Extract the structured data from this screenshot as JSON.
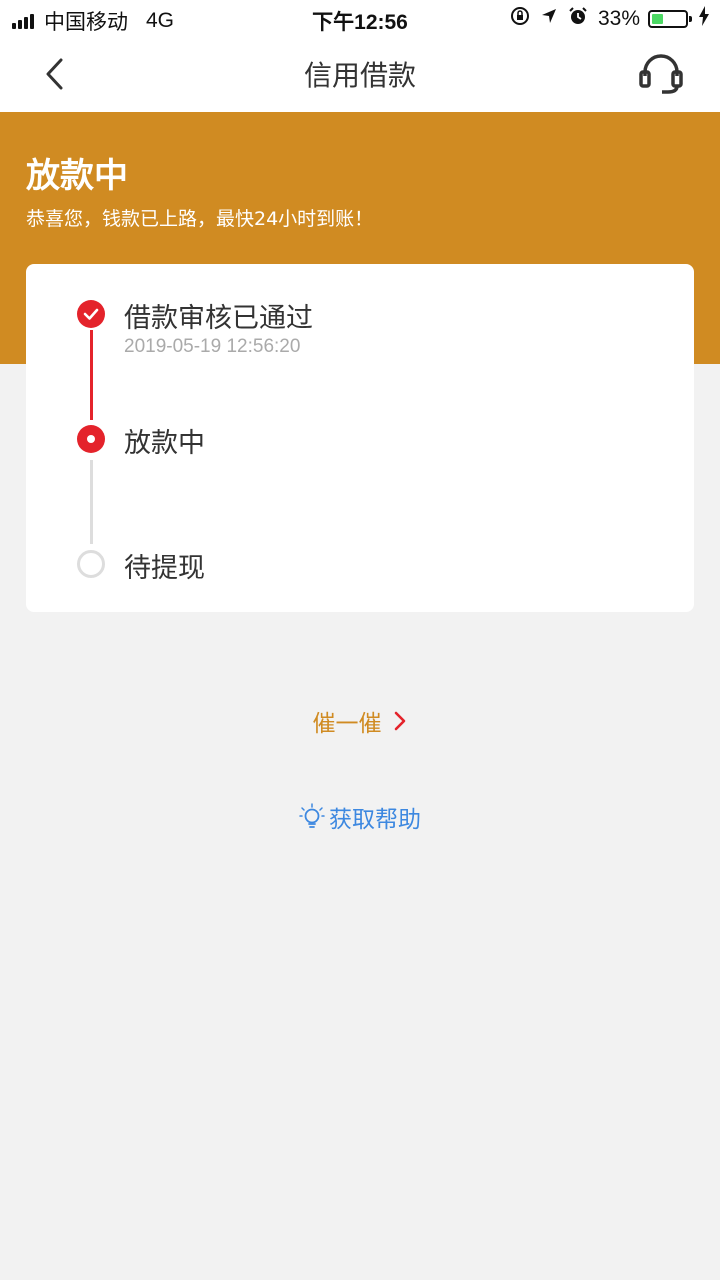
{
  "status_bar": {
    "carrier": "中国移动",
    "network": "4G",
    "time": "下午12:56",
    "battery": "33%",
    "battery_level": 0.33,
    "icons": [
      "signal-icon",
      "orientation-lock-icon",
      "location-icon",
      "alarm-icon",
      "battery-icon",
      "charging-icon"
    ]
  },
  "nav": {
    "title": "信用借款",
    "back_icon": "chevron-left-icon",
    "support_icon": "headset-icon"
  },
  "hero": {
    "title": "放款中",
    "subtitle": "恭喜您，钱款已上路，最快24小时到账！",
    "background_color": "#d08b22"
  },
  "progress": {
    "steps": [
      {
        "label": "借款审核已通过",
        "time": "2019-05-19 12:56:20",
        "state": "done"
      },
      {
        "label": "放款中",
        "time": "",
        "state": "active"
      },
      {
        "label": "待提现",
        "time": "",
        "state": "pending"
      }
    ],
    "accent_color": "#e4232b"
  },
  "actions": {
    "urge_label": "催一催",
    "help_label": "获取帮助",
    "urge_color": "#d08b22",
    "help_color": "#3d88e0"
  }
}
